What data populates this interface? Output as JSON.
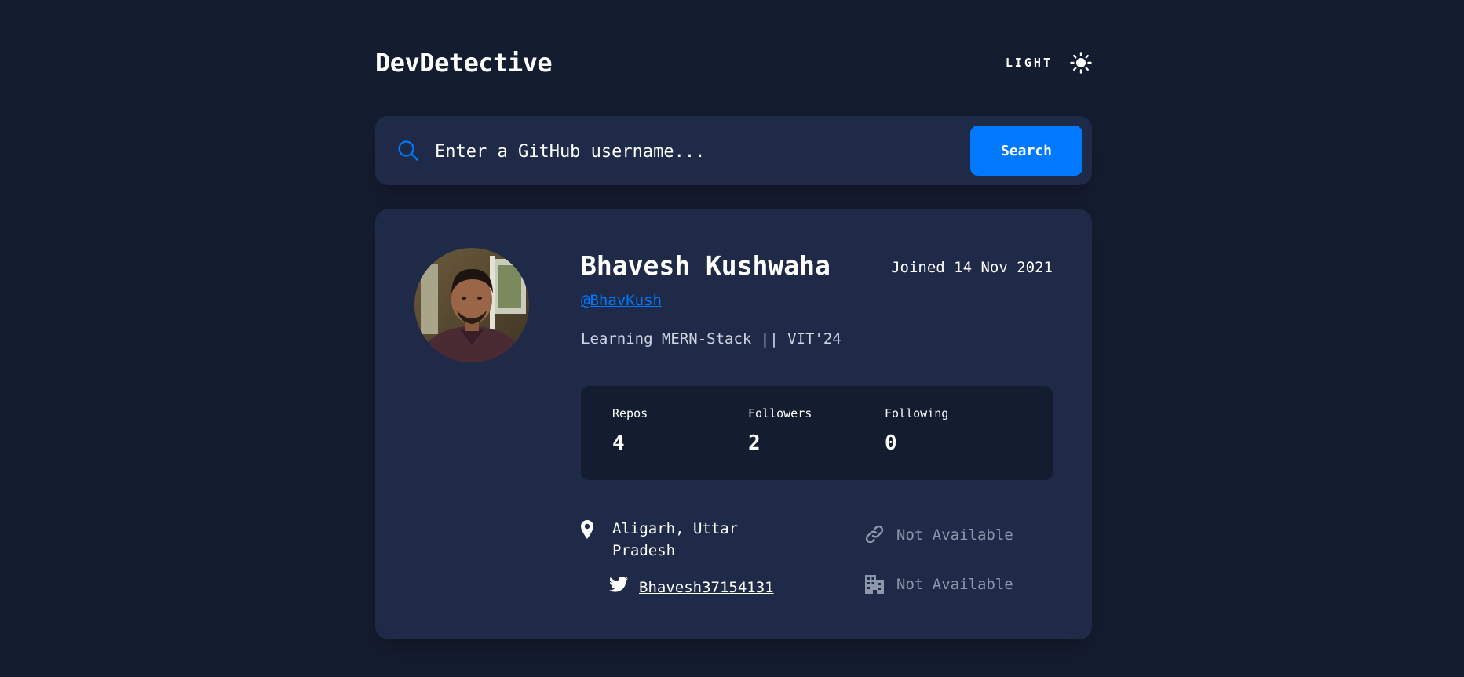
{
  "header": {
    "logo": "DevDetective",
    "theme_label": "LIGHT",
    "theme_icon": "sun-icon"
  },
  "search": {
    "placeholder": "Enter a GitHub username...",
    "value": "",
    "icon": "search-icon",
    "button_label": "Search"
  },
  "profile": {
    "name": "Bhavesh Kushwaha",
    "joined": "Joined 14 Nov 2021",
    "username": "@BhavKush",
    "bio": "Learning MERN-Stack || VIT'24",
    "stats": {
      "repos_label": "Repos",
      "repos_value": "4",
      "followers_label": "Followers",
      "followers_value": "2",
      "following_label": "Following",
      "following_value": "0"
    },
    "info": {
      "location_line1": "Aligarh, Uttar",
      "location_line2": "Pradesh",
      "website": "Not Available",
      "twitter": "Bhavesh37154131",
      "company": "Not Available"
    }
  },
  "colors": {
    "background": "#141c2f",
    "card": "#1f2a48",
    "accent": "#0079ff",
    "muted": "#8e96aa"
  }
}
